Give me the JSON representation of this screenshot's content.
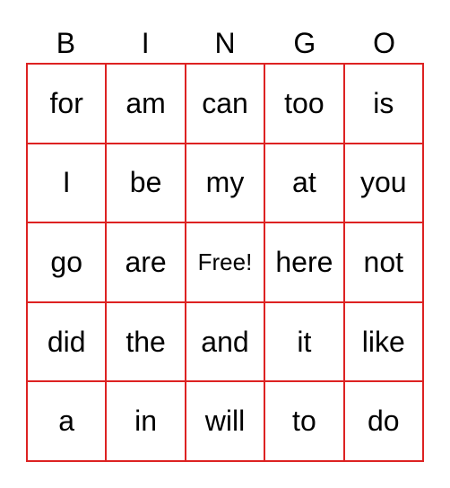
{
  "header": [
    "B",
    "I",
    "N",
    "G",
    "O"
  ],
  "border_color": "#dd2222",
  "rows": [
    [
      "for",
      "am",
      "can",
      "too",
      "is"
    ],
    [
      "I",
      "be",
      "my",
      "at",
      "you"
    ],
    [
      "go",
      "are",
      "Free!",
      "here",
      "not"
    ],
    [
      "did",
      "the",
      "and",
      "it",
      "like"
    ],
    [
      "a",
      "in",
      "will",
      "to",
      "do"
    ]
  ]
}
